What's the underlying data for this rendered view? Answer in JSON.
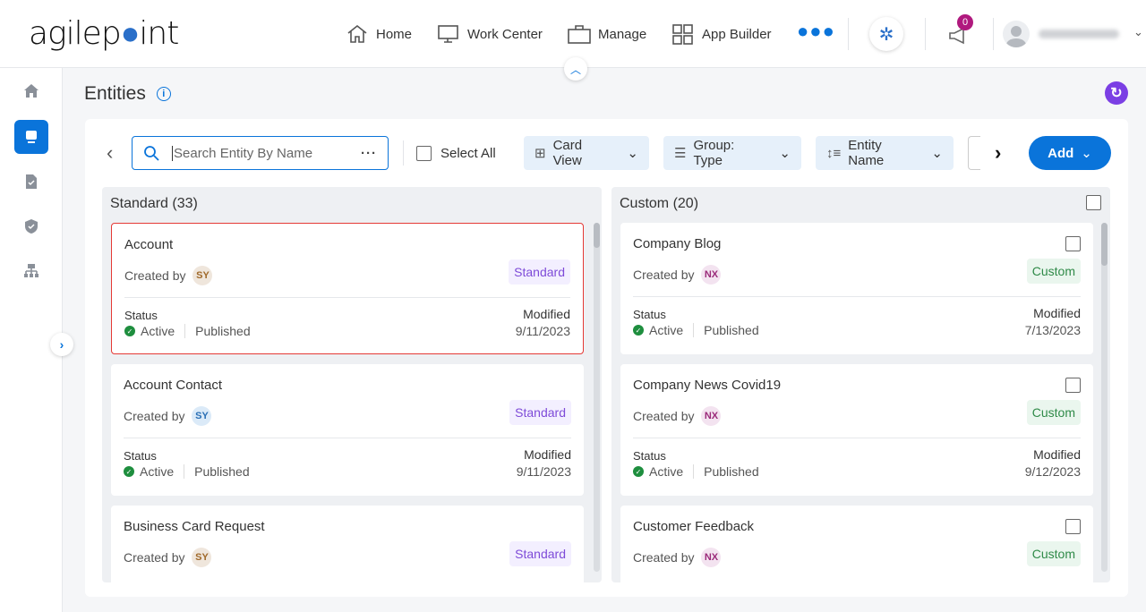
{
  "header": {
    "logo": "agilepoint",
    "nav": [
      {
        "label": "Home",
        "icon": "home-icon"
      },
      {
        "label": "Work Center",
        "icon": "monitor-icon"
      },
      {
        "label": "Manage",
        "icon": "briefcase-icon"
      },
      {
        "label": "App Builder",
        "icon": "grid-icon"
      }
    ],
    "notification_count": "0"
  },
  "page": {
    "title": "Entities"
  },
  "toolbar": {
    "search_placeholder": "Search Entity By Name",
    "select_all": "Select All",
    "view": "Card View",
    "group": "Group: Type",
    "sort": "Entity Name",
    "add": "Add"
  },
  "colors": {
    "accent": "#0a74da",
    "standard_badge": "#7e4bd8",
    "custom_badge": "#2f8a48",
    "refresh": "#7b3fe4"
  },
  "standard": {
    "title": "Standard (33)",
    "cards": [
      {
        "name": "Account",
        "created_by_label": "Created by",
        "initials": "SY",
        "type": "Standard",
        "status_label": "Status",
        "status": "Active",
        "published": "Published",
        "modified_label": "Modified",
        "modified": "9/11/2023",
        "selected": true
      },
      {
        "name": "Account Contact",
        "created_by_label": "Created by",
        "initials": "SY",
        "type": "Standard",
        "status_label": "Status",
        "status": "Active",
        "published": "Published",
        "modified_label": "Modified",
        "modified": "9/11/2023"
      },
      {
        "name": "Business Card Request",
        "created_by_label": "Created by",
        "initials": "SY",
        "type": "Standard"
      }
    ]
  },
  "custom": {
    "title": "Custom (20)",
    "cards": [
      {
        "name": "Company Blog",
        "created_by_label": "Created by",
        "initials": "NX",
        "type": "Custom",
        "status_label": "Status",
        "status": "Active",
        "published": "Published",
        "modified_label": "Modified",
        "modified": "7/13/2023"
      },
      {
        "name": "Company News Covid19",
        "created_by_label": "Created by",
        "initials": "NX",
        "type": "Custom",
        "status_label": "Status",
        "status": "Active",
        "published": "Published",
        "modified_label": "Modified",
        "modified": "9/12/2023"
      },
      {
        "name": "Customer Feedback",
        "created_by_label": "Created by",
        "initials": "NX",
        "type": "Custom"
      }
    ]
  }
}
